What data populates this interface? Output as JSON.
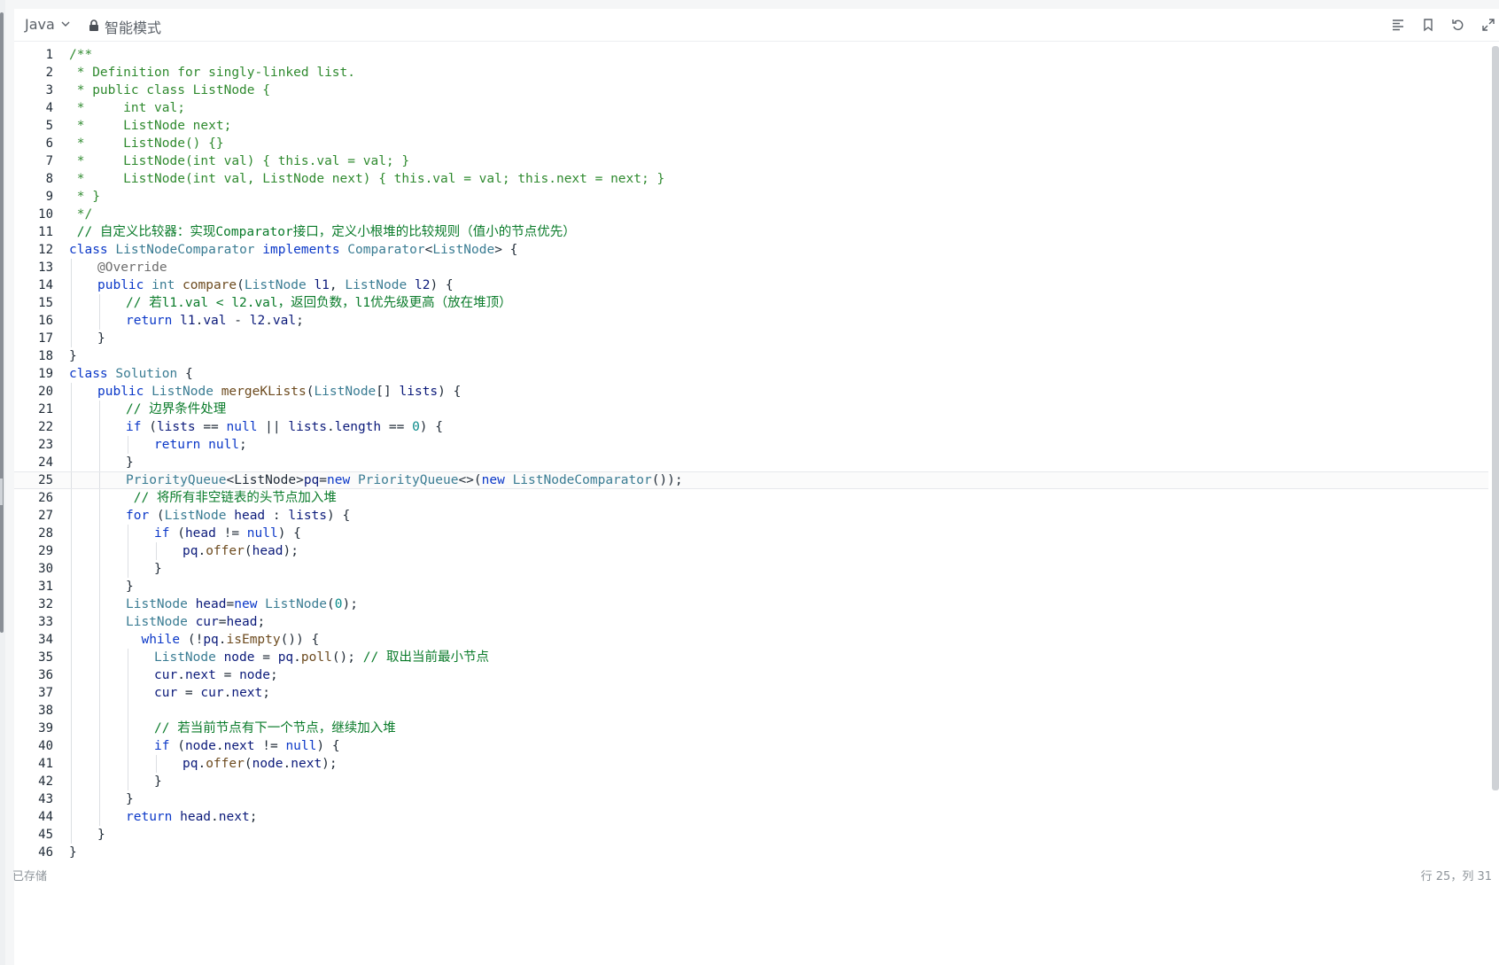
{
  "header": {
    "language": "Java",
    "mode_label": "智能模式"
  },
  "icons": {
    "format": "format-icon",
    "bookmark": "bookmark-icon",
    "undo": "undo-icon",
    "expand": "expand-icon",
    "lock": "lock-icon",
    "chevron": "chevron-down-icon"
  },
  "status": {
    "saved": "已存储",
    "cursor": "行 25，列 31"
  },
  "current_line": 25,
  "code_lines": [
    {
      "n": 1,
      "indent": 0,
      "tokens": [
        [
          "c",
          "/**"
        ]
      ]
    },
    {
      "n": 2,
      "indent": 0,
      "tokens": [
        [
          "c",
          " * Definition for singly-linked list."
        ]
      ]
    },
    {
      "n": 3,
      "indent": 0,
      "tokens": [
        [
          "c",
          " * public class ListNode {"
        ]
      ]
    },
    {
      "n": 4,
      "indent": 0,
      "tokens": [
        [
          "c",
          " *     int val;"
        ]
      ]
    },
    {
      "n": 5,
      "indent": 0,
      "tokens": [
        [
          "c",
          " *     ListNode next;"
        ]
      ]
    },
    {
      "n": 6,
      "indent": 0,
      "tokens": [
        [
          "c",
          " *     ListNode() {}"
        ]
      ]
    },
    {
      "n": 7,
      "indent": 0,
      "tokens": [
        [
          "c",
          " *     ListNode(int val) { this.val = val; }"
        ]
      ]
    },
    {
      "n": 8,
      "indent": 0,
      "tokens": [
        [
          "c",
          " *     ListNode(int val, ListNode next) { this.val = val; this.next = next; }"
        ]
      ]
    },
    {
      "n": 9,
      "indent": 0,
      "tokens": [
        [
          "c",
          " * }"
        ]
      ]
    },
    {
      "n": 10,
      "indent": 0,
      "tokens": [
        [
          "c",
          " */"
        ]
      ]
    },
    {
      "n": 11,
      "indent": 0,
      "tokens": [
        [
          "cm",
          " // 自定义比较器：实现Comparator接口，定义小根堆的比较规则（值小的节点优先）"
        ]
      ]
    },
    {
      "n": 12,
      "indent": 0,
      "tokens": [
        [
          "k",
          "class "
        ],
        [
          "t",
          "ListNodeComparator "
        ],
        [
          "k",
          "implements "
        ],
        [
          "t",
          "Comparator"
        ],
        [
          "n",
          "<"
        ],
        [
          "t",
          "ListNode"
        ],
        [
          "n",
          "> {"
        ]
      ]
    },
    {
      "n": 13,
      "indent": 1,
      "tokens": [
        [
          "a",
          "@"
        ],
        [
          "a",
          "Override"
        ]
      ]
    },
    {
      "n": 14,
      "indent": 1,
      "tokens": [
        [
          "k",
          "public "
        ],
        [
          "t",
          "int "
        ],
        [
          "m",
          "compare"
        ],
        [
          "n",
          "("
        ],
        [
          "t",
          "ListNode "
        ],
        [
          "v",
          "l1"
        ],
        [
          "n",
          ", "
        ],
        [
          "t",
          "ListNode "
        ],
        [
          "v",
          "l2"
        ],
        [
          "n",
          ") {"
        ]
      ]
    },
    {
      "n": 15,
      "indent": 2,
      "tokens": [
        [
          "cm",
          "// 若l1.val < l2.val，返回负数，l1优先级更高（放在堆顶）"
        ]
      ]
    },
    {
      "n": 16,
      "indent": 2,
      "tokens": [
        [
          "k",
          "return "
        ],
        [
          "v",
          "l1"
        ],
        [
          "n",
          "."
        ],
        [
          "v",
          "val"
        ],
        [
          "n",
          " - "
        ],
        [
          "v",
          "l2"
        ],
        [
          "n",
          "."
        ],
        [
          "v",
          "val"
        ],
        [
          "n",
          ";"
        ]
      ]
    },
    {
      "n": 17,
      "indent": 1,
      "tokens": [
        [
          "n",
          "}"
        ]
      ]
    },
    {
      "n": 18,
      "indent": 0,
      "tokens": [
        [
          "n",
          "}"
        ]
      ]
    },
    {
      "n": 19,
      "indent": 0,
      "tokens": [
        [
          "k",
          "class "
        ],
        [
          "t",
          "Solution "
        ],
        [
          "n",
          "{"
        ]
      ]
    },
    {
      "n": 20,
      "indent": 1,
      "tokens": [
        [
          "k",
          "public "
        ],
        [
          "t",
          "ListNode "
        ],
        [
          "m",
          "mergeKLists"
        ],
        [
          "n",
          "("
        ],
        [
          "t",
          "ListNode"
        ],
        [
          "n",
          "[] "
        ],
        [
          "v",
          "lists"
        ],
        [
          "n",
          ") {"
        ]
      ]
    },
    {
      "n": 21,
      "indent": 2,
      "tokens": [
        [
          "cm",
          "// 边界条件处理"
        ]
      ]
    },
    {
      "n": 22,
      "indent": 2,
      "tokens": [
        [
          "k",
          "if "
        ],
        [
          "n",
          "("
        ],
        [
          "v",
          "lists"
        ],
        [
          "n",
          " == "
        ],
        [
          "k",
          "null"
        ],
        [
          "n",
          " || "
        ],
        [
          "v",
          "lists"
        ],
        [
          "n",
          "."
        ],
        [
          "v",
          "length"
        ],
        [
          "n",
          " == "
        ],
        [
          "num",
          "0"
        ],
        [
          "n",
          ") {"
        ]
      ]
    },
    {
      "n": 23,
      "indent": 3,
      "tokens": [
        [
          "k",
          "return "
        ],
        [
          "k",
          "null"
        ],
        [
          "n",
          ";"
        ]
      ]
    },
    {
      "n": 24,
      "indent": 2,
      "tokens": [
        [
          "n",
          "}"
        ]
      ]
    },
    {
      "n": 25,
      "indent": 2,
      "tokens": [
        [
          "t",
          "PriorityQueue"
        ],
        [
          "n",
          "<ListNode>"
        ],
        [
          "v",
          "pq"
        ],
        [
          "n",
          "="
        ],
        [
          "k",
          "new "
        ],
        [
          "t",
          "PriorityQueue"
        ],
        [
          "n",
          "<>("
        ],
        [
          "k",
          "new "
        ],
        [
          "t",
          "ListNodeComparator"
        ],
        [
          "n",
          "());"
        ]
      ]
    },
    {
      "n": 26,
      "indent": 2,
      "tokens": [
        [
          "cm",
          " // 将所有非空链表的头节点加入堆"
        ]
      ]
    },
    {
      "n": 27,
      "indent": 2,
      "tokens": [
        [
          "k",
          "for "
        ],
        [
          "n",
          "("
        ],
        [
          "t",
          "ListNode "
        ],
        [
          "v",
          "head"
        ],
        [
          "n",
          " : "
        ],
        [
          "v",
          "lists"
        ],
        [
          "n",
          ") {"
        ]
      ]
    },
    {
      "n": 28,
      "indent": 3,
      "tokens": [
        [
          "k",
          "if "
        ],
        [
          "n",
          "("
        ],
        [
          "v",
          "head"
        ],
        [
          "n",
          " != "
        ],
        [
          "k",
          "null"
        ],
        [
          "n",
          ") {"
        ]
      ]
    },
    {
      "n": 29,
      "indent": 4,
      "tokens": [
        [
          "v",
          "pq"
        ],
        [
          "n",
          "."
        ],
        [
          "m",
          "offer"
        ],
        [
          "n",
          "("
        ],
        [
          "v",
          "head"
        ],
        [
          "n",
          ");"
        ]
      ]
    },
    {
      "n": 30,
      "indent": 3,
      "tokens": [
        [
          "n",
          "}"
        ]
      ]
    },
    {
      "n": 31,
      "indent": 2,
      "tokens": [
        [
          "n",
          "}"
        ]
      ]
    },
    {
      "n": 32,
      "indent": 2,
      "tokens": [
        [
          "t",
          "ListNode "
        ],
        [
          "v",
          "head"
        ],
        [
          "n",
          "="
        ],
        [
          "k",
          "new "
        ],
        [
          "t",
          "ListNode"
        ],
        [
          "n",
          "("
        ],
        [
          "num",
          "0"
        ],
        [
          "n",
          ");"
        ]
      ]
    },
    {
      "n": 33,
      "indent": 2,
      "tokens": [
        [
          "t",
          "ListNode "
        ],
        [
          "v",
          "cur"
        ],
        [
          "n",
          "="
        ],
        [
          "v",
          "head"
        ],
        [
          "n",
          ";"
        ]
      ]
    },
    {
      "n": 34,
      "indent": 2,
      "tokens": [
        [
          "k",
          "  while "
        ],
        [
          "n",
          "(!"
        ],
        [
          "v",
          "pq"
        ],
        [
          "n",
          "."
        ],
        [
          "m",
          "isEmpty"
        ],
        [
          "n",
          "()) {"
        ]
      ]
    },
    {
      "n": 35,
      "indent": 3,
      "tokens": [
        [
          "t",
          "ListNode "
        ],
        [
          "v",
          "node"
        ],
        [
          "n",
          " = "
        ],
        [
          "v",
          "pq"
        ],
        [
          "n",
          "."
        ],
        [
          "m",
          "poll"
        ],
        [
          "n",
          "(); "
        ],
        [
          "cm",
          "// 取出当前最小节点"
        ]
      ]
    },
    {
      "n": 36,
      "indent": 3,
      "tokens": [
        [
          "v",
          "cur"
        ],
        [
          "n",
          "."
        ],
        [
          "v",
          "next"
        ],
        [
          "n",
          " = "
        ],
        [
          "v",
          "node"
        ],
        [
          "n",
          ";"
        ]
      ]
    },
    {
      "n": 37,
      "indent": 3,
      "tokens": [
        [
          "v",
          "cur"
        ],
        [
          "n",
          " = "
        ],
        [
          "v",
          "cur"
        ],
        [
          "n",
          "."
        ],
        [
          "v",
          "next"
        ],
        [
          "n",
          ";"
        ]
      ]
    },
    {
      "n": 38,
      "indent": 3,
      "tokens": []
    },
    {
      "n": 39,
      "indent": 3,
      "tokens": [
        [
          "cm",
          "// 若当前节点有下一个节点，继续加入堆"
        ]
      ]
    },
    {
      "n": 40,
      "indent": 3,
      "tokens": [
        [
          "k",
          "if "
        ],
        [
          "n",
          "("
        ],
        [
          "v",
          "node"
        ],
        [
          "n",
          "."
        ],
        [
          "v",
          "next"
        ],
        [
          "n",
          " != "
        ],
        [
          "k",
          "null"
        ],
        [
          "n",
          ") {"
        ]
      ]
    },
    {
      "n": 41,
      "indent": 4,
      "tokens": [
        [
          "v",
          "pq"
        ],
        [
          "n",
          "."
        ],
        [
          "m",
          "offer"
        ],
        [
          "n",
          "("
        ],
        [
          "v",
          "node"
        ],
        [
          "n",
          "."
        ],
        [
          "v",
          "next"
        ],
        [
          "n",
          ");"
        ]
      ]
    },
    {
      "n": 42,
      "indent": 3,
      "tokens": [
        [
          "n",
          "}"
        ]
      ]
    },
    {
      "n": 43,
      "indent": 2,
      "tokens": [
        [
          "n",
          "}"
        ]
      ]
    },
    {
      "n": 44,
      "indent": 2,
      "tokens": [
        [
          "k",
          "return "
        ],
        [
          "v",
          "head"
        ],
        [
          "n",
          "."
        ],
        [
          "v",
          "next"
        ],
        [
          "n",
          ";"
        ]
      ]
    },
    {
      "n": 45,
      "indent": 1,
      "tokens": [
        [
          "n",
          "}"
        ]
      ]
    },
    {
      "n": 46,
      "indent": 0,
      "tokens": [
        [
          "n",
          "}"
        ]
      ]
    }
  ]
}
